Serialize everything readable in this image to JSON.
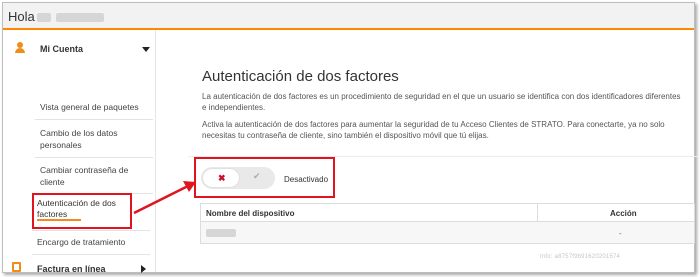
{
  "header": {
    "greeting": "Hola"
  },
  "sidebar": {
    "section_title": "Mi Cuenta",
    "items": [
      {
        "label": "Vista general de paquetes"
      },
      {
        "label": "Cambio de los datos personales"
      },
      {
        "label": "Cambiar contraseña de cliente"
      },
      {
        "label": "Autenticación de dos factores",
        "active": true
      },
      {
        "label": "Encargo de tratamiento"
      }
    ],
    "next_section": "Factura en línea"
  },
  "main": {
    "title": "Autenticación de dos factores",
    "paragraph1": "La autenticación de dos factores es un procedimiento de seguridad en el que un usuario se identifica con dos identificadores diferentes e independientes.",
    "paragraph2": "Activa la autenticación de dos factores para aumentar la seguridad de tu Acceso Clientes de STRATO. Para conectarte, ya no solo necesitas tu contraseña de cliente, sino también el dispositivo móvil que tú elijas.",
    "toggle": {
      "state_label": "Desactivado",
      "off_symbol": "✖",
      "on_symbol": "✔"
    },
    "table": {
      "headers": [
        "Nombre del dispositivo",
        "Acción"
      ],
      "rows": [
        {
          "action": "-"
        }
      ]
    },
    "info_code": "Info: a8757f9b91620201574"
  },
  "colors": {
    "accent": "#ff8800",
    "highlight": "#e0141e"
  },
  "icons": [
    "user-icon",
    "chevron-down-icon",
    "document-icon",
    "chevron-right-icon",
    "close-icon",
    "check-icon"
  ]
}
